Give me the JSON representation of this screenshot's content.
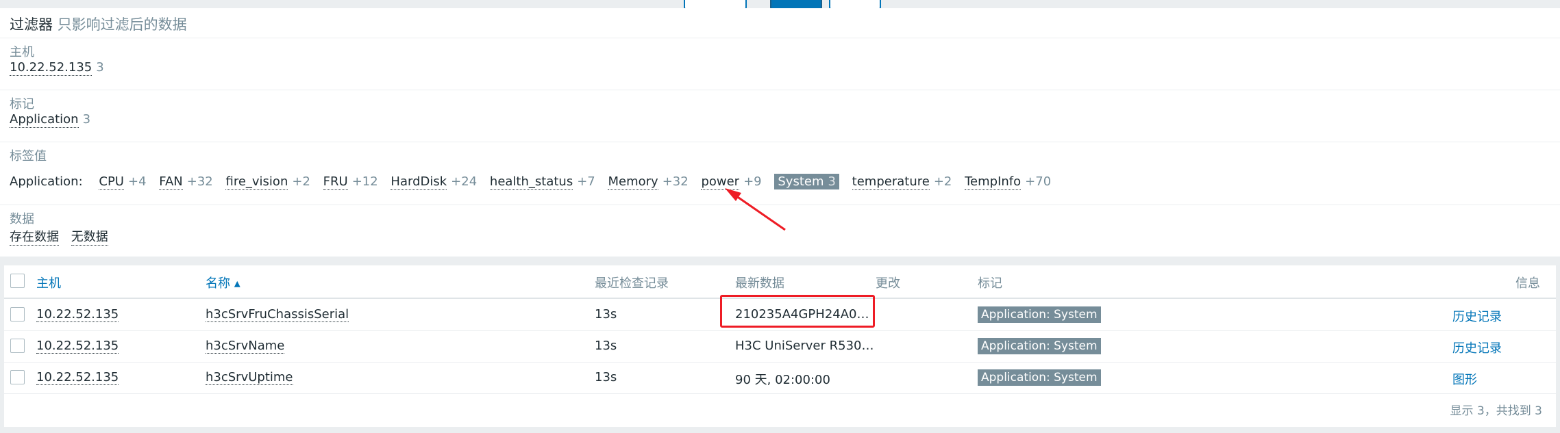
{
  "filter": {
    "title": "过滤器",
    "subtitle": "只影响过滤后的数据",
    "host": {
      "label": "主机",
      "value": "10.22.52.135",
      "count": "3"
    },
    "tag": {
      "label": "标记",
      "value": "Application",
      "count": "3"
    },
    "tag_values": {
      "label": "标签值",
      "prefix": "Application:",
      "items": [
        {
          "name": "CPU",
          "count": "+4"
        },
        {
          "name": "FAN",
          "count": "+32"
        },
        {
          "name": "fire_vision",
          "count": "+2"
        },
        {
          "name": "FRU",
          "count": "+12"
        },
        {
          "name": "HardDisk",
          "count": "+24"
        },
        {
          "name": "health_status",
          "count": "+7"
        },
        {
          "name": "Memory",
          "count": "+32"
        },
        {
          "name": "power",
          "count": "+9"
        },
        {
          "name": "System",
          "count": "3"
        },
        {
          "name": "temperature",
          "count": "+2"
        },
        {
          "name": "TempInfo",
          "count": "+70"
        }
      ],
      "selected": "System"
    },
    "data": {
      "label": "数据",
      "options": [
        "存在数据",
        "无数据"
      ]
    }
  },
  "table": {
    "headers": {
      "host": "主机",
      "name": "名称 ▴",
      "last_check": "最近检查记录",
      "latest": "最新数据",
      "change": "更改",
      "tags": "标记",
      "info": "信息"
    },
    "rows": [
      {
        "host": "10.22.52.135",
        "name": "h3cSrvFruChassisSerial",
        "last_check": "13s",
        "latest": "210235A4GPH24A0…",
        "tag": "Application: System",
        "action": "历史记录"
      },
      {
        "host": "10.22.52.135",
        "name": "h3cSrvName",
        "last_check": "13s",
        "latest": "H3C UniServer R530…",
        "tag": "Application: System",
        "action": "历史记录"
      },
      {
        "host": "10.22.52.135",
        "name": "h3cSrvUptime",
        "last_check": "13s",
        "latest": "90 天, 02:00:00",
        "tag": "Application: System",
        "action": "图形"
      }
    ],
    "footer": "显示 3，共找到 3"
  },
  "colors": {
    "accent": "#0275b8",
    "highlight": "#ee1c25",
    "badge": "#768d99"
  },
  "icons": {
    "sort": "sort-asc-icon",
    "annotation": "red-arrow-icon"
  }
}
